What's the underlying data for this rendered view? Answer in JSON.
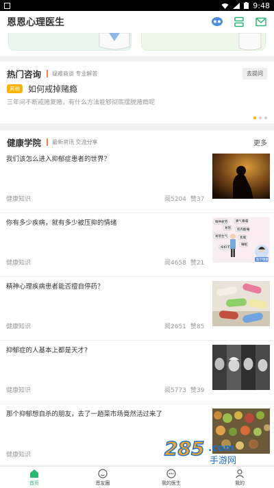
{
  "status_bar": {
    "time": "9:48"
  },
  "app_bar": {
    "title": "恩恩心理医生",
    "icons": [
      "chat-bubble-icon",
      "layers-icon",
      "mail-icon"
    ]
  },
  "hot_consult": {
    "title": "热门咨询",
    "subtitle": "疑难商谈 专业解答",
    "ask_button": "去提问",
    "tag": "其他",
    "question": "如何戒掉赌瘾",
    "description": "三年间不断戒赌复赌，有什么方法能够彻底摆脱赌瘾呢"
  },
  "health_academy": {
    "title": "健康学院",
    "subtitle": "最新资讯 交流分享",
    "more": "更多",
    "articles": [
      {
        "title": "我们该怎么进入抑郁症患者的世界？",
        "category": "健康知识",
        "reads": "阅5204",
        "likes": "赞37",
        "image": "silhouette-photo"
      },
      {
        "title": "你有多少疾病，就有多少被压抑的情绪",
        "category": "健康知识",
        "reads": "阅4658",
        "likes": "赞21",
        "image": "illustration-emotions"
      },
      {
        "title": "精神心理疾病患者能否擅自停药？",
        "category": "健康知识",
        "reads": "阅2651",
        "likes": "赞85",
        "image": "pills-photo"
      },
      {
        "title": "抑郁症的人基本上都是天才?",
        "category": "健康知识",
        "reads": "阅5773",
        "likes": "赞39",
        "image": "portraits-photo"
      },
      {
        "title": "那个抑郁想自杀的朋友，去了一趟菜市场竟然活过来了",
        "category": "健康知识",
        "reads": "",
        "likes": "",
        "image": "market-photo"
      }
    ],
    "illustration_words": [
      "精神疲劳",
      "脾气暴躁",
      "易怒",
      "肌肉酸痛",
      "易怒生气",
      "焦躁",
      "睡眠",
      "扣扣子",
      "医学健康"
    ]
  },
  "tab_bar": {
    "tabs": [
      {
        "label": "首页",
        "icon": "home-icon"
      },
      {
        "label": "恩友圈",
        "icon": "smile-icon"
      },
      {
        "label": "我的医生",
        "icon": "chat-dots-icon"
      },
      {
        "label": "我的",
        "icon": "user-icon"
      }
    ]
  },
  "watermark": {
    "text": "285",
    "domain": ".com",
    "caption": "手游网"
  },
  "colors": {
    "accent": "#2bb673",
    "tag": "#ffb300",
    "bar": "#ff7a45"
  }
}
